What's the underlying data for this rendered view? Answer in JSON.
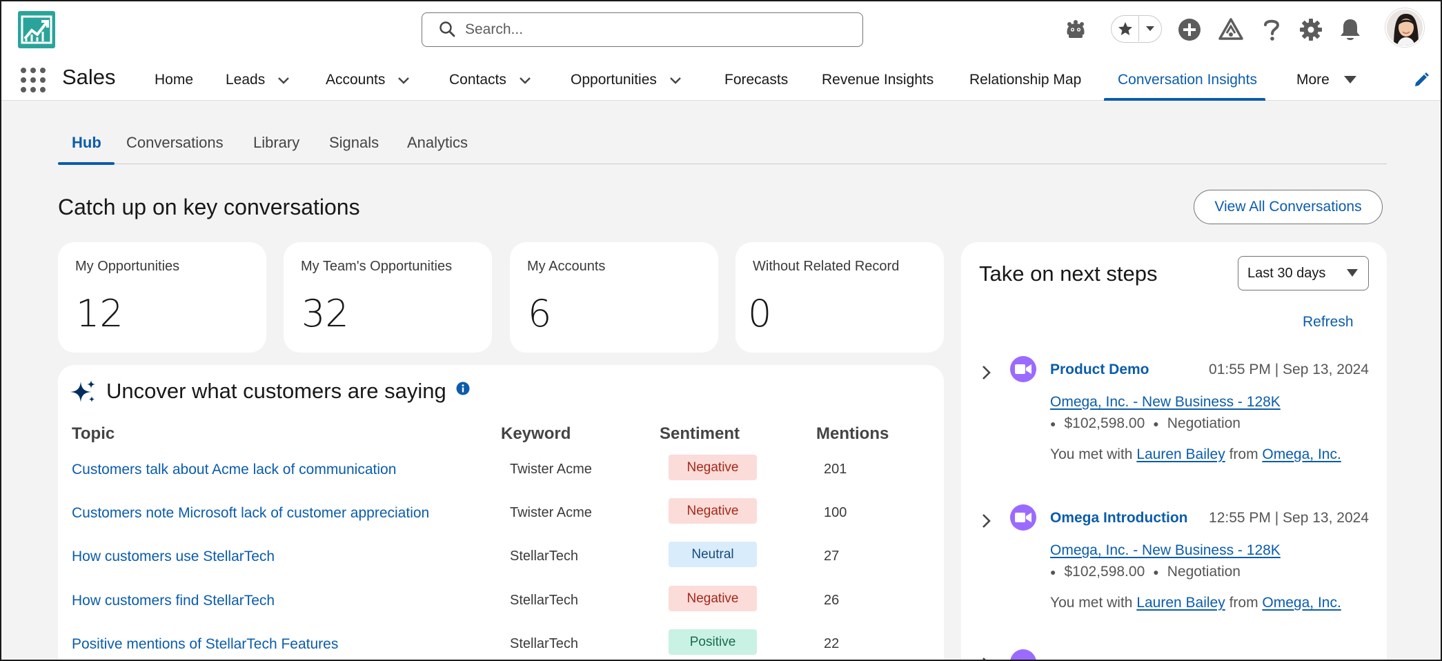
{
  "header": {
    "search_placeholder": "Search...",
    "icons": [
      "app-logo-icon",
      "search-icon",
      "agent-icon",
      "star-icon",
      "chevron-down-icon",
      "plus-icon",
      "trailhead-icon",
      "help-icon",
      "gear-icon",
      "bell-icon"
    ]
  },
  "nav": {
    "app_name": "Sales",
    "items": [
      {
        "label": "Home",
        "has_menu": false
      },
      {
        "label": "Leads",
        "has_menu": true
      },
      {
        "label": "Accounts",
        "has_menu": true
      },
      {
        "label": "Contacts",
        "has_menu": true
      },
      {
        "label": "Opportunities",
        "has_menu": true
      },
      {
        "label": "Forecasts",
        "has_menu": false
      },
      {
        "label": "Revenue Insights",
        "has_menu": false
      },
      {
        "label": "Relationship Map",
        "has_menu": false
      },
      {
        "label": "Conversation Insights",
        "has_menu": false,
        "active": true
      },
      {
        "label": "More",
        "has_menu": true
      }
    ]
  },
  "subtabs": [
    {
      "label": "Hub",
      "active": true
    },
    {
      "label": "Conversations"
    },
    {
      "label": "Library"
    },
    {
      "label": "Signals"
    },
    {
      "label": "Analytics"
    }
  ],
  "main": {
    "title": "Catch up on key conversations",
    "view_all_label": "View All Conversations",
    "stats": [
      {
        "label": "My Opportunities",
        "value": "12"
      },
      {
        "label": "My Team's Opportunities",
        "value": "32"
      },
      {
        "label": "My Accounts",
        "value": "6"
      },
      {
        "label": "Without Related Record",
        "value": "0"
      }
    ]
  },
  "topics": {
    "title": "Uncover what customers are saying",
    "columns": [
      "Topic",
      "Keyword",
      "Sentiment",
      "Mentions"
    ],
    "rows": [
      {
        "topic": "Customers talk about Acme lack of communication",
        "keyword": "Twister Acme",
        "sentiment": "Negative",
        "mentions": "201"
      },
      {
        "topic": "Customers note Microsoft lack of customer appreciation",
        "keyword": "Twister Acme",
        "sentiment": "Negative",
        "mentions": "100"
      },
      {
        "topic": "How customers use StellarTech",
        "keyword": "StellarTech",
        "sentiment": "Neutral",
        "mentions": "27"
      },
      {
        "topic": "How customers find StellarTech",
        "keyword": "StellarTech",
        "sentiment": "Negative",
        "mentions": "26"
      },
      {
        "topic": "Positive mentions of StellarTech Features",
        "keyword": "StellarTech",
        "sentiment": "Positive",
        "mentions": "22"
      }
    ],
    "sentiment_colors": {
      "Negative": "#fbdcd8",
      "Neutral": "#d9ecfb",
      "Positive": "#c9f1e4"
    }
  },
  "next_steps": {
    "title": "Take on next steps",
    "range_value": "Last 30 days",
    "refresh_label": "Refresh",
    "items": [
      {
        "name": "Product Demo",
        "time": "01:55 PM | Sep 13, 2024",
        "opportunity": "Omega, Inc. - New Business - 128K",
        "amount": "$102,598.00",
        "stage": "Negotiation",
        "met_prefix": "You met with",
        "contact": "Lauren Bailey",
        "from_word": "from",
        "account": "Omega, Inc."
      },
      {
        "name": "Omega Introduction",
        "time": "12:55 PM | Sep 13, 2024",
        "opportunity": "Omega, Inc. - New Business - 128K",
        "amount": "$102,598.00",
        "stage": "Negotiation",
        "met_prefix": "You met with",
        "contact": "Lauren Bailey",
        "from_word": "from",
        "account": "Omega, Inc."
      }
    ]
  },
  "colors": {
    "brand": "#0b5cab",
    "logo": "#2aa49a",
    "video_icon": "#9b6bff"
  }
}
